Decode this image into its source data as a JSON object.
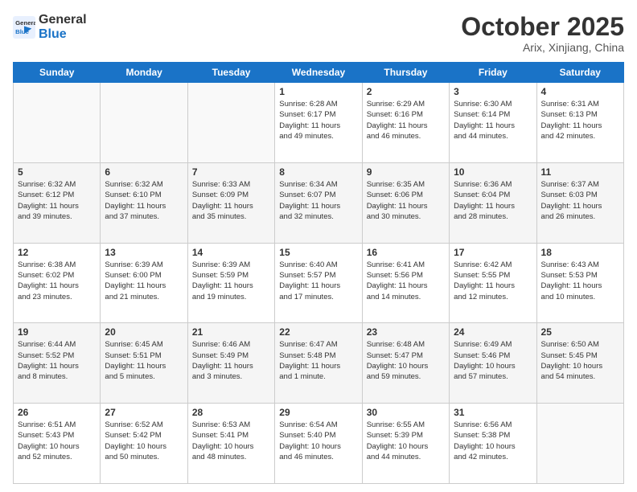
{
  "logo": {
    "line1": "General",
    "line2": "Blue"
  },
  "title": "October 2025",
  "subtitle": "Arix, Xinjiang, China",
  "days_header": [
    "Sunday",
    "Monday",
    "Tuesday",
    "Wednesday",
    "Thursday",
    "Friday",
    "Saturday"
  ],
  "weeks": [
    [
      {
        "day": "",
        "info": ""
      },
      {
        "day": "",
        "info": ""
      },
      {
        "day": "",
        "info": ""
      },
      {
        "day": "1",
        "info": "Sunrise: 6:28 AM\nSunset: 6:17 PM\nDaylight: 11 hours\nand 49 minutes."
      },
      {
        "day": "2",
        "info": "Sunrise: 6:29 AM\nSunset: 6:16 PM\nDaylight: 11 hours\nand 46 minutes."
      },
      {
        "day": "3",
        "info": "Sunrise: 6:30 AM\nSunset: 6:14 PM\nDaylight: 11 hours\nand 44 minutes."
      },
      {
        "day": "4",
        "info": "Sunrise: 6:31 AM\nSunset: 6:13 PM\nDaylight: 11 hours\nand 42 minutes."
      }
    ],
    [
      {
        "day": "5",
        "info": "Sunrise: 6:32 AM\nSunset: 6:12 PM\nDaylight: 11 hours\nand 39 minutes."
      },
      {
        "day": "6",
        "info": "Sunrise: 6:32 AM\nSunset: 6:10 PM\nDaylight: 11 hours\nand 37 minutes."
      },
      {
        "day": "7",
        "info": "Sunrise: 6:33 AM\nSunset: 6:09 PM\nDaylight: 11 hours\nand 35 minutes."
      },
      {
        "day": "8",
        "info": "Sunrise: 6:34 AM\nSunset: 6:07 PM\nDaylight: 11 hours\nand 32 minutes."
      },
      {
        "day": "9",
        "info": "Sunrise: 6:35 AM\nSunset: 6:06 PM\nDaylight: 11 hours\nand 30 minutes."
      },
      {
        "day": "10",
        "info": "Sunrise: 6:36 AM\nSunset: 6:04 PM\nDaylight: 11 hours\nand 28 minutes."
      },
      {
        "day": "11",
        "info": "Sunrise: 6:37 AM\nSunset: 6:03 PM\nDaylight: 11 hours\nand 26 minutes."
      }
    ],
    [
      {
        "day": "12",
        "info": "Sunrise: 6:38 AM\nSunset: 6:02 PM\nDaylight: 11 hours\nand 23 minutes."
      },
      {
        "day": "13",
        "info": "Sunrise: 6:39 AM\nSunset: 6:00 PM\nDaylight: 11 hours\nand 21 minutes."
      },
      {
        "day": "14",
        "info": "Sunrise: 6:39 AM\nSunset: 5:59 PM\nDaylight: 11 hours\nand 19 minutes."
      },
      {
        "day": "15",
        "info": "Sunrise: 6:40 AM\nSunset: 5:57 PM\nDaylight: 11 hours\nand 17 minutes."
      },
      {
        "day": "16",
        "info": "Sunrise: 6:41 AM\nSunset: 5:56 PM\nDaylight: 11 hours\nand 14 minutes."
      },
      {
        "day": "17",
        "info": "Sunrise: 6:42 AM\nSunset: 5:55 PM\nDaylight: 11 hours\nand 12 minutes."
      },
      {
        "day": "18",
        "info": "Sunrise: 6:43 AM\nSunset: 5:53 PM\nDaylight: 11 hours\nand 10 minutes."
      }
    ],
    [
      {
        "day": "19",
        "info": "Sunrise: 6:44 AM\nSunset: 5:52 PM\nDaylight: 11 hours\nand 8 minutes."
      },
      {
        "day": "20",
        "info": "Sunrise: 6:45 AM\nSunset: 5:51 PM\nDaylight: 11 hours\nand 5 minutes."
      },
      {
        "day": "21",
        "info": "Sunrise: 6:46 AM\nSunset: 5:49 PM\nDaylight: 11 hours\nand 3 minutes."
      },
      {
        "day": "22",
        "info": "Sunrise: 6:47 AM\nSunset: 5:48 PM\nDaylight: 11 hours\nand 1 minute."
      },
      {
        "day": "23",
        "info": "Sunrise: 6:48 AM\nSunset: 5:47 PM\nDaylight: 10 hours\nand 59 minutes."
      },
      {
        "day": "24",
        "info": "Sunrise: 6:49 AM\nSunset: 5:46 PM\nDaylight: 10 hours\nand 57 minutes."
      },
      {
        "day": "25",
        "info": "Sunrise: 6:50 AM\nSunset: 5:45 PM\nDaylight: 10 hours\nand 54 minutes."
      }
    ],
    [
      {
        "day": "26",
        "info": "Sunrise: 6:51 AM\nSunset: 5:43 PM\nDaylight: 10 hours\nand 52 minutes."
      },
      {
        "day": "27",
        "info": "Sunrise: 6:52 AM\nSunset: 5:42 PM\nDaylight: 10 hours\nand 50 minutes."
      },
      {
        "day": "28",
        "info": "Sunrise: 6:53 AM\nSunset: 5:41 PM\nDaylight: 10 hours\nand 48 minutes."
      },
      {
        "day": "29",
        "info": "Sunrise: 6:54 AM\nSunset: 5:40 PM\nDaylight: 10 hours\nand 46 minutes."
      },
      {
        "day": "30",
        "info": "Sunrise: 6:55 AM\nSunset: 5:39 PM\nDaylight: 10 hours\nand 44 minutes."
      },
      {
        "day": "31",
        "info": "Sunrise: 6:56 AM\nSunset: 5:38 PM\nDaylight: 10 hours\nand 42 minutes."
      },
      {
        "day": "",
        "info": ""
      }
    ]
  ]
}
